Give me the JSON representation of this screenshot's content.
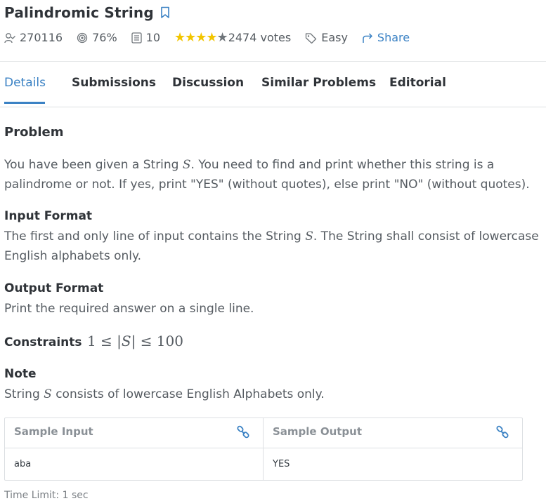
{
  "problem": {
    "title": "Palindromic String"
  },
  "meta": {
    "solved_count": "270116",
    "success_rate": "76%",
    "max_score": "10",
    "rating": 4,
    "stars_filled": "★★★★",
    "star_empty": "★",
    "votes": "2474 votes",
    "difficulty": "Easy",
    "share_label": "Share"
  },
  "tabs": [
    {
      "label": "Details"
    },
    {
      "label": "Submissions"
    },
    {
      "label": "Discussion"
    },
    {
      "label": "Similar Problems"
    },
    {
      "label": "Editorial"
    }
  ],
  "content": {
    "problem_heading": "Problem",
    "problem_text_1": "You have been given a String ",
    "problem_var_s": "S",
    "problem_text_2": ". You need to find and print whether this string is a palindrome or not. If yes, print \"YES\" (without quotes), else print \"NO\" (without quotes).",
    "input_heading": "Input Format",
    "input_text_1": "The first and only line of input contains the String ",
    "input_var_s": "S",
    "input_text_2": ". The String shall consist of lowercase English alphabets only.",
    "output_heading": "Output Format",
    "output_text": "Print the required answer on a single line.",
    "constraints_label": "Constraints",
    "constraints_expr_1": "1 ≤ |",
    "constraints_var": "S",
    "constraints_expr_2": "| ≤ 100",
    "note_heading": "Note",
    "note_text_1": "String ",
    "note_var_s": "S",
    "note_text_2": " consists of lowercase English Alphabets only.",
    "cutoff_text": "Time Limit: 1 sec"
  },
  "sample": {
    "input_heading": "Sample Input",
    "output_heading": "Sample Output",
    "input_value": "aba",
    "output_value": "YES"
  },
  "colors": {
    "accent": "#3b82c4",
    "star": "#f2c500",
    "text": "#555b61",
    "heading": "#2f3338"
  }
}
